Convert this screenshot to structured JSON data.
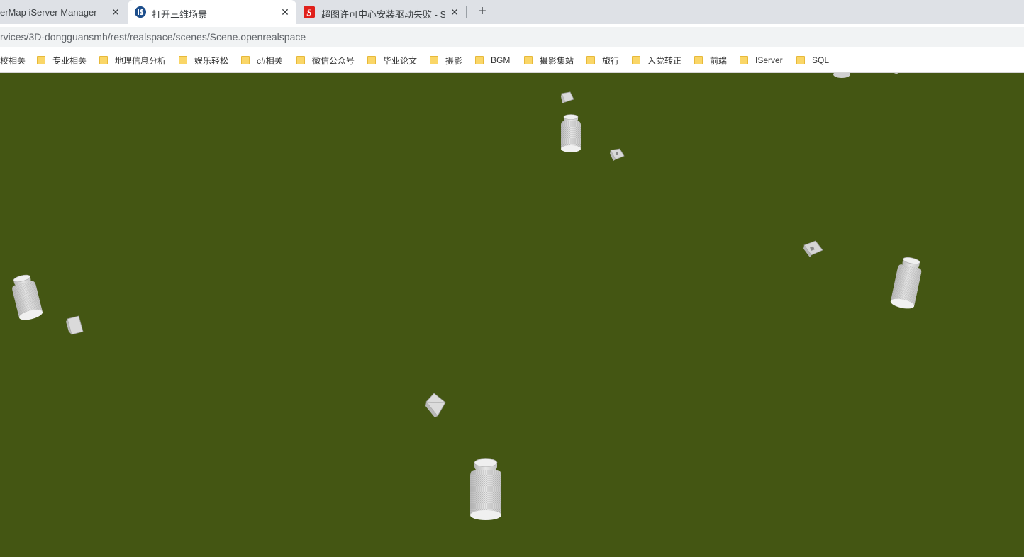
{
  "tabs": [
    {
      "title": "erMap iServer Manager",
      "active": false
    },
    {
      "title": "打开三维场景",
      "active": true
    },
    {
      "title": "超图许可中心安装驱动失败 - Sup",
      "active": false
    }
  ],
  "new_tab_symbol": "+",
  "close_symbol": "✕",
  "address_bar": {
    "url": "rvices/3D-dongguansmh/rest/realspace/scenes/Scene.openrealspace"
  },
  "bookmarks": [
    "校相关",
    "专业相关",
    "地理信息分析",
    "娱乐轻松",
    "c#相关",
    "微信公众号",
    "毕业论文",
    "摄影",
    "BGM",
    "摄影集站",
    "旅行",
    "入党转正",
    "前端",
    "IServer",
    "SQL"
  ],
  "scene": {
    "background_color": "#445613",
    "objects": [
      {
        "kind": "bottle",
        "name": "bottle-top-center"
      },
      {
        "kind": "box",
        "name": "box-top-1"
      },
      {
        "kind": "box",
        "name": "box-top-2"
      },
      {
        "kind": "box",
        "name": "box-right"
      },
      {
        "kind": "bottle",
        "name": "bottle-right"
      },
      {
        "kind": "bottle",
        "name": "bottle-left"
      },
      {
        "kind": "box",
        "name": "box-left"
      },
      {
        "kind": "box",
        "name": "box-center"
      },
      {
        "kind": "bottle",
        "name": "bottle-bottom-center"
      },
      {
        "kind": "bottle",
        "name": "bottle-top-right-partial"
      }
    ]
  },
  "colors": {
    "tab_strip": "#dee1e6",
    "favicon_iserver": "#1e4f8c",
    "favicon_supermap": "#e0201b",
    "folder": "#fad667"
  }
}
